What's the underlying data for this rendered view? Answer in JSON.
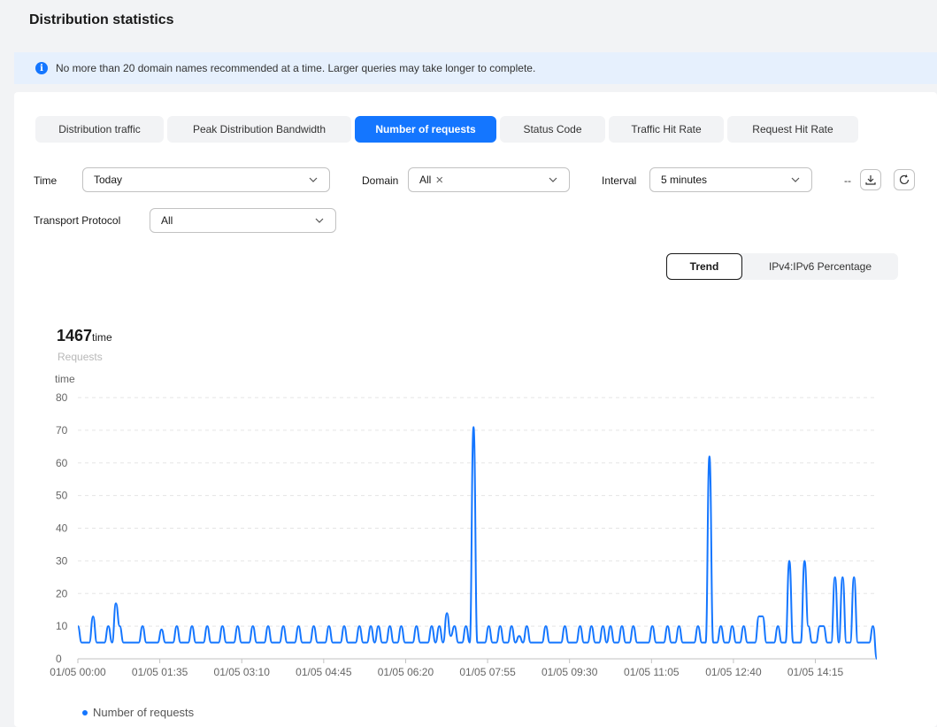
{
  "page": {
    "title": "Distribution statistics"
  },
  "notice": {
    "text": "No more than 20 domain names recommended at a time. Larger queries may take longer to complete."
  },
  "tabs": [
    {
      "label": "Distribution traffic",
      "active": false
    },
    {
      "label": "Peak Distribution Bandwidth",
      "active": false
    },
    {
      "label": "Number of requests",
      "active": true
    },
    {
      "label": "Status Code",
      "active": false
    },
    {
      "label": "Traffic Hit Rate",
      "active": false
    },
    {
      "label": "Request Hit Rate",
      "active": false
    }
  ],
  "filters": {
    "time_label": "Time",
    "time_value": "Today",
    "domain_label": "Domain",
    "domain_value": "All",
    "interval_label": "Interval",
    "interval_value": "5 minutes",
    "protocol_label": "Transport Protocol",
    "protocol_value": "All",
    "dash": "--"
  },
  "view_toggle": {
    "trend": "Trend",
    "ipv_percentage": "IPv4:IPv6 Percentage",
    "selected": "Trend"
  },
  "summary": {
    "value": "1467",
    "unit": "time",
    "label": "Requests"
  },
  "colors": {
    "accent": "#1476ff",
    "grid": "#e5e5e5"
  },
  "chart_data": {
    "type": "line",
    "ylabel": "time",
    "ylim": [
      0,
      80
    ],
    "yticks": [
      0,
      10,
      20,
      30,
      40,
      50,
      60,
      70,
      80
    ],
    "x_tick_labels": [
      "01/05 00:00",
      "01/05 01:35",
      "01/05 03:10",
      "01/05 04:45",
      "01/05 06:20",
      "01/05 07:55",
      "01/05 09:30",
      "01/05 11:05",
      "01/05 12:40",
      "01/05 14:15"
    ],
    "x_interval": "5 minutes",
    "series": [
      {
        "name": "Number of requests",
        "color": "#1476ff",
        "values": [
          10,
          5,
          5,
          5,
          13,
          5,
          5,
          5,
          10,
          5,
          17,
          10,
          5,
          5,
          5,
          5,
          5,
          10,
          5,
          5,
          5,
          5,
          9,
          5,
          5,
          5,
          10,
          5,
          5,
          5,
          10,
          5,
          5,
          5,
          10,
          5,
          5,
          5,
          10,
          5,
          5,
          5,
          10,
          5,
          5,
          5,
          10,
          5,
          5,
          5,
          10,
          5,
          5,
          5,
          10,
          5,
          5,
          5,
          10,
          5,
          5,
          5,
          10,
          5,
          5,
          5,
          10,
          5,
          5,
          5,
          10,
          5,
          5,
          5,
          10,
          5,
          5,
          10,
          5,
          10,
          5,
          5,
          10,
          5,
          5,
          10,
          5,
          5,
          5,
          10,
          5,
          5,
          5,
          10,
          5,
          10,
          5,
          14,
          7,
          10,
          5,
          5,
          10,
          5,
          71,
          5,
          5,
          5,
          10,
          5,
          5,
          10,
          5,
          5,
          10,
          5,
          7,
          5,
          10,
          5,
          5,
          5,
          5,
          10,
          5,
          5,
          5,
          5,
          10,
          5,
          5,
          5,
          10,
          5,
          5,
          10,
          5,
          5,
          10,
          5,
          10,
          5,
          5,
          10,
          5,
          5,
          10,
          5,
          5,
          5,
          5,
          10,
          5,
          5,
          5,
          10,
          5,
          5,
          10,
          5,
          5,
          5,
          5,
          10,
          5,
          5,
          62,
          5,
          5,
          10,
          5,
          5,
          10,
          5,
          5,
          10,
          5,
          5,
          5,
          13,
          13,
          5,
          5,
          5,
          10,
          5,
          5,
          30,
          5,
          5,
          5,
          30,
          10,
          5,
          5,
          10,
          10,
          5,
          5,
          25,
          5,
          25,
          5,
          5,
          25,
          5,
          5,
          5,
          5,
          10,
          0
        ]
      }
    ]
  }
}
